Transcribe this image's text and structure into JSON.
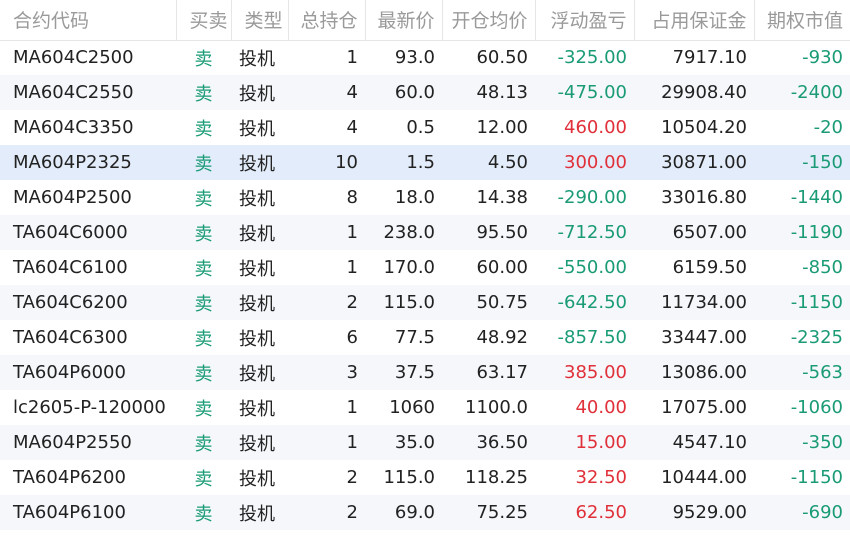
{
  "colors": {
    "loss_green": "#1a9b76",
    "gain_red": "#e0303a",
    "header_gray": "#9a9a9a",
    "selected_row": "#e3ecfa"
  },
  "headers": [
    "合约代码",
    "买卖",
    "类型",
    "总持仓",
    "最新价",
    "开仓均价",
    "浮动盈亏",
    "占用保证金",
    "期权市值"
  ],
  "rows": [
    {
      "code": "MA604C2500",
      "side": "卖",
      "type": "投机",
      "qty": "1",
      "last": "93.0",
      "open": "60.50",
      "pnl": "-325.00",
      "margin": "7917.10",
      "value": "-930"
    },
    {
      "code": "MA604C2550",
      "side": "卖",
      "type": "投机",
      "qty": "4",
      "last": "60.0",
      "open": "48.13",
      "pnl": "-475.00",
      "margin": "29908.40",
      "value": "-2400"
    },
    {
      "code": "MA604C3350",
      "side": "卖",
      "type": "投机",
      "qty": "4",
      "last": "0.5",
      "open": "12.00",
      "pnl": "460.00",
      "margin": "10504.20",
      "value": "-20"
    },
    {
      "code": "MA604P2325",
      "side": "卖",
      "type": "投机",
      "qty": "10",
      "last": "1.5",
      "open": "4.50",
      "pnl": "300.00",
      "margin": "30871.00",
      "value": "-150"
    },
    {
      "code": "MA604P2500",
      "side": "卖",
      "type": "投机",
      "qty": "8",
      "last": "18.0",
      "open": "14.38",
      "pnl": "-290.00",
      "margin": "33016.80",
      "value": "-1440"
    },
    {
      "code": "TA604C6000",
      "side": "卖",
      "type": "投机",
      "qty": "1",
      "last": "238.0",
      "open": "95.50",
      "pnl": "-712.50",
      "margin": "6507.00",
      "value": "-1190"
    },
    {
      "code": "TA604C6100",
      "side": "卖",
      "type": "投机",
      "qty": "1",
      "last": "170.0",
      "open": "60.00",
      "pnl": "-550.00",
      "margin": "6159.50",
      "value": "-850"
    },
    {
      "code": "TA604C6200",
      "side": "卖",
      "type": "投机",
      "qty": "2",
      "last": "115.0",
      "open": "50.75",
      "pnl": "-642.50",
      "margin": "11734.00",
      "value": "-1150"
    },
    {
      "code": "TA604C6300",
      "side": "卖",
      "type": "投机",
      "qty": "6",
      "last": "77.5",
      "open": "48.92",
      "pnl": "-857.50",
      "margin": "33447.00",
      "value": "-2325"
    },
    {
      "code": "TA604P6000",
      "side": "卖",
      "type": "投机",
      "qty": "3",
      "last": "37.5",
      "open": "63.17",
      "pnl": "385.00",
      "margin": "13086.00",
      "value": "-563"
    },
    {
      "code": "lc2605-P-120000",
      "side": "卖",
      "type": "投机",
      "qty": "1",
      "last": "1060",
      "open": "1100.0",
      "pnl": "40.00",
      "margin": "17075.00",
      "value": "-1060"
    },
    {
      "code": "MA604P2550",
      "side": "卖",
      "type": "投机",
      "qty": "1",
      "last": "35.0",
      "open": "36.50",
      "pnl": "15.00",
      "margin": "4547.10",
      "value": "-350"
    },
    {
      "code": "TA604P6200",
      "side": "卖",
      "type": "投机",
      "qty": "2",
      "last": "115.0",
      "open": "118.25",
      "pnl": "32.50",
      "margin": "10444.00",
      "value": "-1150"
    },
    {
      "code": "TA604P6100",
      "side": "卖",
      "type": "投机",
      "qty": "2",
      "last": "69.0",
      "open": "75.25",
      "pnl": "62.50",
      "margin": "9529.00",
      "value": "-690"
    }
  ]
}
